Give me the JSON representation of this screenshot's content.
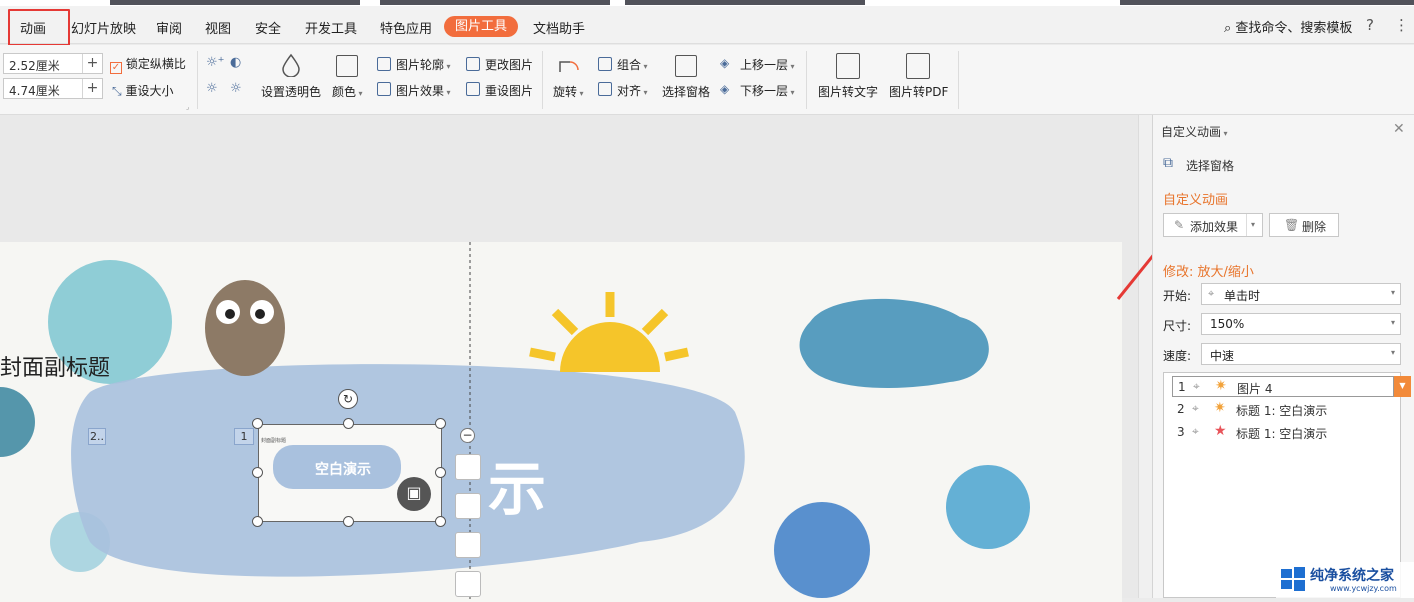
{
  "menu": {
    "items": [
      "动画",
      "幻灯片放映",
      "审阅",
      "视图",
      "安全",
      "开发工具",
      "特色应用",
      "图片工具",
      "文档助手"
    ],
    "active_tab": "图片工具",
    "search": "查找命令、搜索模板",
    "help": "?",
    "more": "⋮"
  },
  "ribbon": {
    "height_value": "2.52厘米",
    "width_value": "4.74厘米",
    "plus": "+",
    "lock_ratio": "锁定纵横比",
    "reset_size": "重设大小",
    "transparency": "设置透明色",
    "color": "颜色",
    "outline": "图片轮廓",
    "effects": "图片效果",
    "change_pic": "更改图片",
    "reset_pic": "重设图片",
    "rotate": "旋转",
    "group": "组合",
    "align": "对齐",
    "select_pane": "选择窗格",
    "bring_forward": "上移一层",
    "send_backward": "下移一层",
    "pic_to_text": "图片转文字",
    "pic_to_pdf": "图片转PDF"
  },
  "slide": {
    "subtitle": "封面副标题",
    "title_partial": "示",
    "thumb_title": "空白演示",
    "thumb_sub": "封面副标题",
    "tag1": "1",
    "tag2": "2.."
  },
  "pane": {
    "header": "自定义动画",
    "select_pane": "选择窗格",
    "section_title": "自定义动画",
    "add_effect": "添加效果",
    "delete": "删除",
    "modify": "修改: 放大/缩小",
    "start_label": "开始:",
    "start_value": "单击时",
    "size_label": "尺寸:",
    "size_value": "150%",
    "speed_label": "速度:",
    "speed_value": "中速",
    "list": [
      {
        "num": "1",
        "name": "图片 4"
      },
      {
        "num": "2",
        "name": "标题 1: 空白演示"
      },
      {
        "num": "3",
        "name": "标题 1: 空白演示"
      }
    ]
  },
  "watermark": {
    "name": "纯净系统之家",
    "url": "www.ycwjzy.com"
  },
  "colors": {
    "accent": "#f26d3d",
    "highlight_box": "#e53935",
    "section_orange": "#e8742b",
    "arrow_red": "#e53935"
  }
}
